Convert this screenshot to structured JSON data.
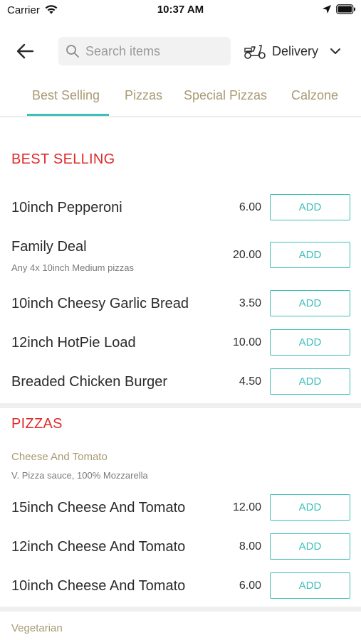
{
  "status_bar": {
    "carrier": "Carrier",
    "time": "10:37 AM"
  },
  "header": {
    "search_placeholder": "Search items",
    "delivery_label": "Delivery"
  },
  "tabs": [
    {
      "label": "Best Selling",
      "active": true
    },
    {
      "label": "Pizzas",
      "active": false
    },
    {
      "label": "Special Pizzas",
      "active": false
    },
    {
      "label": "Calzone",
      "active": false
    }
  ],
  "sections": {
    "best_selling": {
      "title": "BEST SELLING",
      "items": [
        {
          "name": "10inch Pepperoni",
          "price": "6.00",
          "add": "ADD"
        },
        {
          "name": "Family Deal",
          "desc": "Any 4x 10inch Medium pizzas",
          "price": "20.00",
          "add": "ADD"
        },
        {
          "name": "10inch Cheesy Garlic Bread",
          "price": "3.50",
          "add": "ADD"
        },
        {
          "name": "12inch HotPie Load",
          "price": "10.00",
          "add": "ADD"
        },
        {
          "name": "Breaded Chicken Burger",
          "price": "4.50",
          "add": "ADD"
        }
      ]
    },
    "pizzas": {
      "title": "PIZZAS",
      "subcategory": "Cheese And Tomato",
      "subcategory_desc": "V. Pizza sauce, 100% Mozzarella",
      "items": [
        {
          "name": "15inch Cheese And Tomato",
          "price": "12.00",
          "add": "ADD"
        },
        {
          "name": "12inch Cheese And Tomato",
          "price": "8.00",
          "add": "ADD"
        },
        {
          "name": "10inch Cheese And Tomato",
          "price": "6.00",
          "add": "ADD"
        }
      ],
      "next_subcategory": "Vegetarian"
    }
  },
  "colors": {
    "accent": "#3cbfb8",
    "section_title": "#e02a2a",
    "tab_text": "#a89a72"
  },
  "icons": [
    "wifi-icon",
    "location-arrow-icon",
    "battery-icon",
    "back-arrow-icon",
    "search-icon",
    "scooter-icon",
    "chevron-down-icon"
  ]
}
